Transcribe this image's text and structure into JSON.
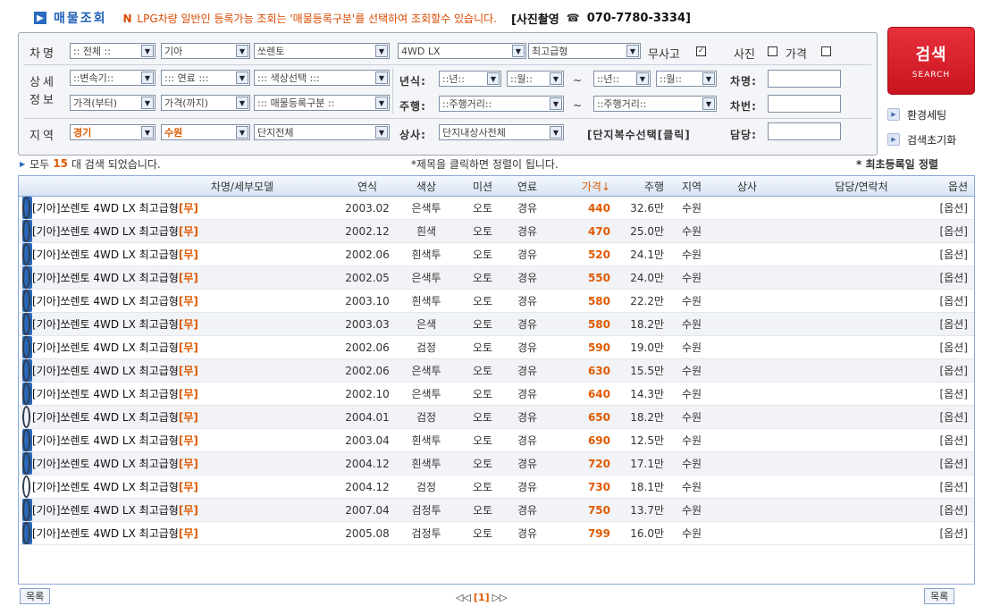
{
  "header": {
    "title": "매물조회",
    "notice_prefix": "N",
    "notice": "LPG차량 일반인 등록가능 조회는 '매물등록구분'를 선택하여 조회할수 있습니다.",
    "photo_label": "[사진촬영",
    "phone": "070-7780-3334]"
  },
  "filters": {
    "car_name_label": "차명",
    "all": ":: 전체 ::",
    "maker": "기아",
    "model": "쏘렌토",
    "trim": "4WD LX",
    "grade": "최고급형",
    "accident_free": "무사고",
    "photo": "사진",
    "price": "가격",
    "detail_label_1": "상세",
    "detail_label_2": "정보",
    "transmission": "::변속기::",
    "fuel": "::: 연료 :::",
    "color": "::: 색상선택 :::",
    "price_from": "가격(부터)",
    "price_to": "가격(까지)",
    "reg_type": "::: 매물등록구분 ::",
    "year_label": "년식:",
    "year_from": "::년::",
    "month_from": "::월::",
    "year_to": "::년::",
    "month_to": "::월::",
    "tilde": "~",
    "mileage_label": "주행:",
    "mileage_from": "::주행거리::",
    "mileage_to": "::주행거리::",
    "car_name_field": "차명:",
    "plate_field": "차번:",
    "region_label": "지역",
    "region": "경기",
    "city": "수원",
    "complex": "단지전체",
    "dealer_label": "상사:",
    "dealer": "단지내상사전체",
    "multi_select": "[단지복수선택[클릭]",
    "manager_label": "담당:"
  },
  "buttons": {
    "search_k": "검색",
    "search_e": "SEARCH",
    "settings": "환경세팅",
    "reset": "검색초기화"
  },
  "info": {
    "prefix": "모두",
    "count": "15",
    "suffix": "대 검색 되었습니다.",
    "sort_hint": "*제목을 클릭하면 정렬이 됩니다.",
    "sort_first": "* 최초등록일 정렬"
  },
  "table": {
    "headers": [
      "차명/세부모델",
      "연식",
      "색상",
      "미션",
      "연료",
      "가격↓",
      "주행",
      "지역",
      "상사",
      "담당/연락처",
      "옵션"
    ],
    "rows": [
      {
        "cam": true,
        "name": "[기아]쏘렌토 4WD LX 최고급형",
        "tag": "[무]",
        "year": "2003.02",
        "color": "은색투",
        "mission": "오토",
        "fuel": "경유",
        "price": "440",
        "mileage": "32.6만",
        "region": "수원",
        "option": "[옵션]"
      },
      {
        "cam": true,
        "name": "[기아]쏘렌토 4WD LX 최고급형",
        "tag": "[무]",
        "year": "2002.12",
        "color": "흰색",
        "mission": "오토",
        "fuel": "경유",
        "price": "470",
        "mileage": "25.0만",
        "region": "수원",
        "option": "[옵션]"
      },
      {
        "cam": true,
        "name": "[기아]쏘렌토 4WD LX 최고급형",
        "tag": "[무]",
        "year": "2002.06",
        "color": "흰색투",
        "mission": "오토",
        "fuel": "경유",
        "price": "520",
        "mileage": "24.1만",
        "region": "수원",
        "option": "[옵션]"
      },
      {
        "cam": true,
        "name": "[기아]쏘렌토 4WD LX 최고급형",
        "tag": "[무]",
        "year": "2002.05",
        "color": "은색투",
        "mission": "오토",
        "fuel": "경유",
        "price": "550",
        "mileage": "24.0만",
        "region": "수원",
        "option": "[옵션]"
      },
      {
        "cam": true,
        "name": "[기아]쏘렌토 4WD LX 최고급형",
        "tag": "[무]",
        "year": "2003.10",
        "color": "흰색투",
        "mission": "오토",
        "fuel": "경유",
        "price": "580",
        "mileage": "22.2만",
        "region": "수원",
        "option": "[옵션]"
      },
      {
        "cam": true,
        "name": "[기아]쏘렌토 4WD LX 최고급형",
        "tag": "[무]",
        "year": "2003.03",
        "color": "은색",
        "mission": "오토",
        "fuel": "경유",
        "price": "580",
        "mileage": "18.2만",
        "region": "수원",
        "option": "[옵션]"
      },
      {
        "cam": true,
        "name": "[기아]쏘렌토 4WD LX 최고급형",
        "tag": "[무]",
        "year": "2002.06",
        "color": "검정",
        "mission": "오토",
        "fuel": "경유",
        "price": "590",
        "mileage": "19.0만",
        "region": "수원",
        "option": "[옵션]"
      },
      {
        "cam": true,
        "name": "[기아]쏘렌토 4WD LX 최고급형",
        "tag": "[무]",
        "year": "2002.06",
        "color": "은색투",
        "mission": "오토",
        "fuel": "경유",
        "price": "630",
        "mileage": "15.5만",
        "region": "수원",
        "option": "[옵션]"
      },
      {
        "cam": true,
        "name": "[기아]쏘렌토 4WD LX 최고급형",
        "tag": "[무]",
        "year": "2002.10",
        "color": "은색투",
        "mission": "오토",
        "fuel": "경유",
        "price": "640",
        "mileage": "14.3만",
        "region": "수원",
        "option": "[옵션]"
      },
      {
        "cam": false,
        "name": "[기아]쏘렌토 4WD LX 최고급형",
        "tag": "[무]",
        "year": "2004.01",
        "color": "검정",
        "mission": "오토",
        "fuel": "경유",
        "price": "650",
        "mileage": "18.2만",
        "region": "수원",
        "option": "[옵션]"
      },
      {
        "cam": true,
        "name": "[기아]쏘렌토 4WD LX 최고급형",
        "tag": "[무]",
        "year": "2003.04",
        "color": "흰색투",
        "mission": "오토",
        "fuel": "경유",
        "price": "690",
        "mileage": "12.5만",
        "region": "수원",
        "option": "[옵션]"
      },
      {
        "cam": true,
        "name": "[기아]쏘렌토 4WD LX 최고급형",
        "tag": "[무]",
        "year": "2004.12",
        "color": "흰색투",
        "mission": "오토",
        "fuel": "경유",
        "price": "720",
        "mileage": "17.1만",
        "region": "수원",
        "option": "[옵션]"
      },
      {
        "cam": false,
        "name": "[기아]쏘렌토 4WD LX 최고급형",
        "tag": "[무]",
        "year": "2004.12",
        "color": "검정",
        "mission": "오토",
        "fuel": "경유",
        "price": "730",
        "mileage": "18.1만",
        "region": "수원",
        "option": "[옵션]"
      },
      {
        "cam": true,
        "name": "[기아]쏘렌토 4WD LX 최고급형",
        "tag": "[무]",
        "year": "2007.04",
        "color": "검정투",
        "mission": "오토",
        "fuel": "경유",
        "price": "750",
        "mileage": "13.7만",
        "region": "수원",
        "option": "[옵션]"
      },
      {
        "cam": true,
        "name": "[기아]쏘렌토 4WD LX 최고급형",
        "tag": "[무]",
        "year": "2005.08",
        "color": "검정투",
        "mission": "오토",
        "fuel": "경유",
        "price": "799",
        "mileage": "16.0만",
        "region": "수원",
        "option": "[옵션]"
      }
    ]
  },
  "footer": {
    "list_left": "목록",
    "page": "[1]",
    "list_right": "목록"
  },
  "colors": {
    "accent_orange": "#e05a00",
    "title_blue": "#1e5fb5",
    "search_red": "#d41f2a"
  }
}
